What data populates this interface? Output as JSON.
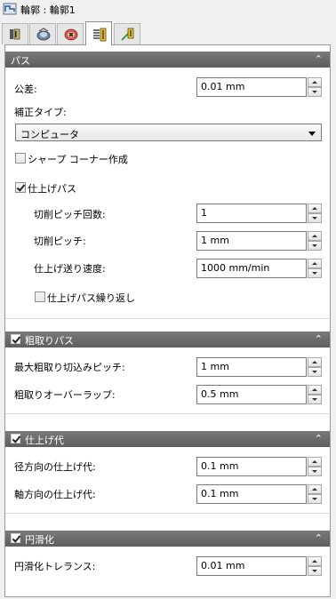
{
  "title": "輪郭 : 輪郭1",
  "tabs": [
    {
      "name": "tool-tab"
    },
    {
      "name": "feature-tab"
    },
    {
      "name": "heights-tab"
    },
    {
      "name": "passes-tab",
      "active": true
    },
    {
      "name": "linking-tab"
    }
  ],
  "sections": {
    "pass": {
      "title": "パス",
      "tolerance": {
        "label": "公差:",
        "value": "0.01 mm"
      },
      "compensation": {
        "label": "補正タイプ:",
        "value": "コンピュータ"
      },
      "sharp_corner": {
        "label": "シャープ コーナー作成",
        "checked": false
      },
      "finishing": {
        "label": "仕上げパス",
        "checked": true
      },
      "stepover_count": {
        "label": "切削ピッチ回数:",
        "value": "1"
      },
      "stepover": {
        "label": "切削ピッチ:",
        "value": "1 mm"
      },
      "feedrate": {
        "label": "仕上げ送り速度:",
        "value": "1000 mm/min"
      },
      "repeat_finishing": {
        "label": "仕上げパス繰り返し",
        "checked": false
      }
    },
    "roughing": {
      "title": "粗取りパス",
      "checked": true,
      "max_stepdown": {
        "label": "最大粗取り切込みピッチ:",
        "value": "1 mm"
      },
      "overlap": {
        "label": "粗取りオーバーラップ:",
        "value": "0.5 mm"
      }
    },
    "stock": {
      "title": "仕上げ代",
      "checked": true,
      "radial": {
        "label": "径方向の仕上げ代:",
        "value": "0.1 mm"
      },
      "axial": {
        "label": "軸方向の仕上げ代:",
        "value": "0.1 mm"
      }
    },
    "smoothing": {
      "title": "円滑化",
      "checked": true,
      "tolerance": {
        "label": "円滑化トレランス:",
        "value": "0.01 mm"
      }
    }
  },
  "collapse_glyph": "⌃"
}
